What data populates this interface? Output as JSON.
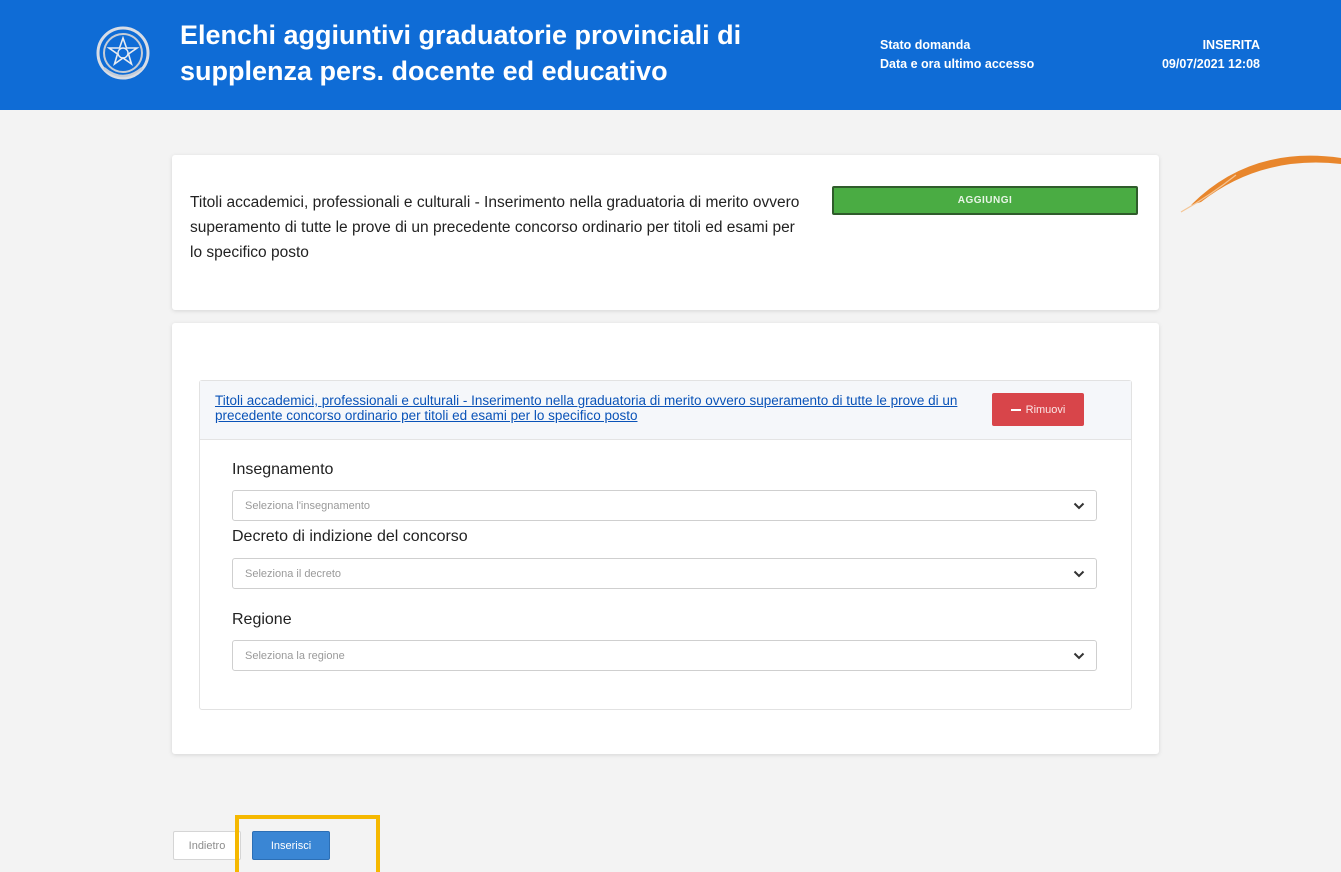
{
  "header": {
    "title_line1": "Elenchi aggiuntivi graduatorie provinciali di",
    "title_line2": "supplenza pers. docente ed educativo",
    "status_label": "Stato domanda",
    "status_value": "INSERITA",
    "access_label": "Data e ora ultimo accesso",
    "access_value": "09/07/2021 12:08",
    "emblem_icon": "italian-republic-emblem-icon",
    "background_color": "#0f6cd6"
  },
  "card_top": {
    "description": "Titoli accademici, professionali e culturali - Inserimento nella graduatoria di merito ovvero superamento di tutte le prove di un precedente concorso ordinario per titoli ed esami per lo specifico posto",
    "add_button": "AGGIUNGI",
    "add_button_color": "#4aac43"
  },
  "section": {
    "title": "Titoli accademici, professionali e culturali - Inserimento nella graduatoria di merito ovvero superamento di tutte le prove di un precedente concorso ordinario per titoli ed esami per lo specifico posto",
    "remove_button": "Rimuovi",
    "remove_icon": "minus-icon",
    "remove_button_color": "#d8454a",
    "fields": [
      {
        "label": "Insegnamento",
        "placeholder": "Seleziona l'insegnamento"
      },
      {
        "label": "Decreto di indizione del concorso",
        "placeholder": "Seleziona il decreto"
      },
      {
        "label": "Regione",
        "placeholder": "Seleziona la regione"
      }
    ]
  },
  "footer": {
    "back_button": "Indietro",
    "submit_button": "Inserisci",
    "submit_color": "#3a86d4",
    "highlight_color": "#f5b800"
  }
}
